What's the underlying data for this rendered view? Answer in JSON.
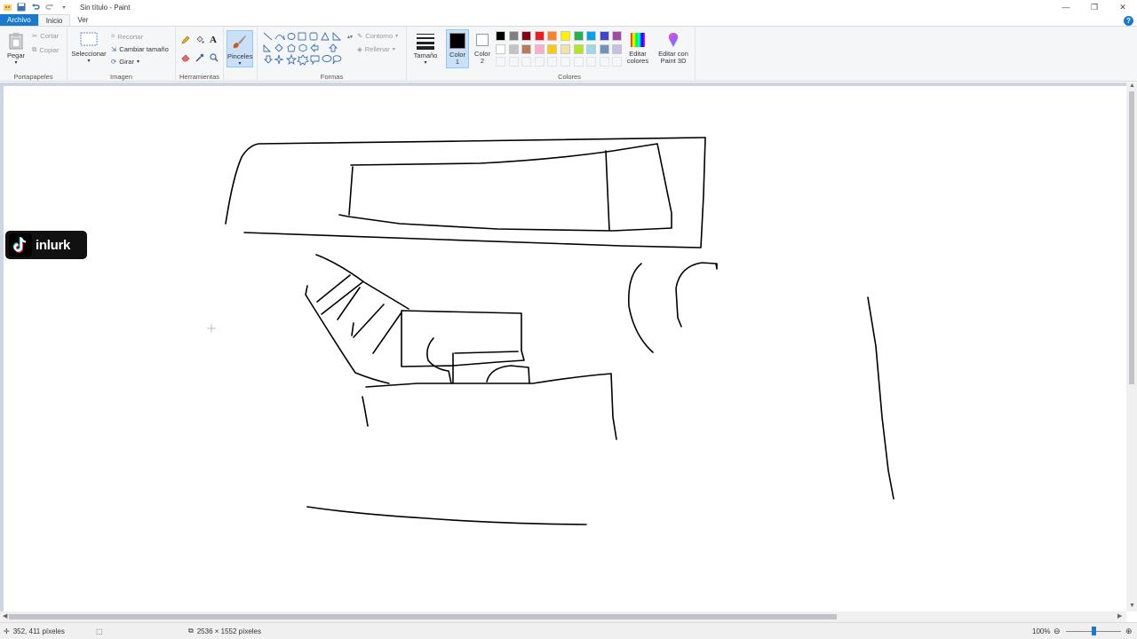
{
  "window": {
    "title": "Sin título - Paint",
    "minimize": "—",
    "restore": "❐",
    "close": "✕"
  },
  "tabs": [
    {
      "label": "Archivo"
    },
    {
      "label": "Inicio"
    },
    {
      "label": "Ver"
    }
  ],
  "ribbon": {
    "clipboard": {
      "group_label": "Portapapeles",
      "paste": "Pegar",
      "cut": "Cortar",
      "copy": "Copiar"
    },
    "image": {
      "group_label": "Imagen",
      "select": "Seleccionar",
      "crop": "Recortar",
      "resize": "Cambiar tamaño",
      "rotate": "Girar"
    },
    "tools": {
      "group_label": "Herramientas"
    },
    "brushes": {
      "label": "Pinceles"
    },
    "shapes": {
      "group_label": "Formas",
      "outline": "Contorno",
      "fill": "Rellenar"
    },
    "size": {
      "label": "Tamaño"
    },
    "colors": {
      "group_label": "Colores",
      "color1": "Color",
      "color1_num": "1",
      "color2": "Color",
      "color2_num": "2",
      "edit_colors_l1": "Editar",
      "edit_colors_l2": "colores",
      "paint3d_l1": "Editar con",
      "paint3d_l2": "Paint 3D",
      "palette": [
        "#000000",
        "#7f7f7f",
        "#880015",
        "#ed1c24",
        "#ff7f27",
        "#fff200",
        "#22b14c",
        "#00a2e8",
        "#3f48cc",
        "#a349a4",
        "#ffffff",
        "#c3c3c3",
        "#b97a57",
        "#ffaec9",
        "#ffc90e",
        "#efe4b0",
        "#b5e61d",
        "#99d9ea",
        "#7092be",
        "#c8bfe7"
      ]
    }
  },
  "watermark": {
    "text": "inlurk"
  },
  "statusbar": {
    "cursor_pos": "352, 411 píxeles",
    "canvas_size": "2536 × 1552 píxeles",
    "zoom": "100%"
  }
}
